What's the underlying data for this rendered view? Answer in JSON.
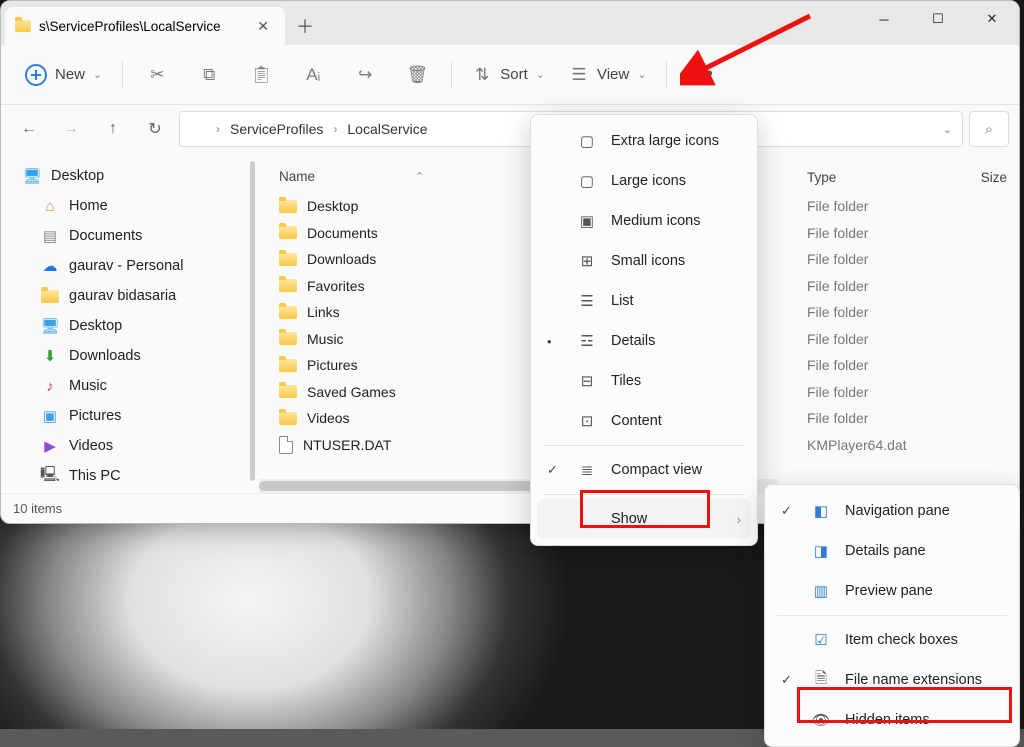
{
  "tab": {
    "title": "s\\ServiceProfiles\\LocalService"
  },
  "toolbar": {
    "new": "New",
    "sort": "Sort",
    "view": "View"
  },
  "breadcrumb": {
    "seg1": "ServiceProfiles",
    "seg2": "LocalService"
  },
  "sidebar": {
    "desktop": "Desktop",
    "home": "Home",
    "documents": "Documents",
    "gaurav_personal": "gaurav - Personal",
    "gaurav_b": "gaurav bidasaria",
    "desktop2": "Desktop",
    "downloads": "Downloads",
    "music": "Music",
    "pictures": "Pictures",
    "videos": "Videos",
    "thispc": "This PC"
  },
  "columns": {
    "name": "Name",
    "type": "Type",
    "size": "Size"
  },
  "files": {
    "f0": "Desktop",
    "f1": "Documents",
    "f2": "Downloads",
    "f3": "Favorites",
    "f4": "Links",
    "f5": "Music",
    "f6": "Pictures",
    "f7": "Saved Games",
    "f8": "Videos",
    "f9": "NTUSER.DAT"
  },
  "types": {
    "folder": "File folder",
    "kmp": "KMPlayer64.dat"
  },
  "status": {
    "count": "10 items"
  },
  "viewMenu": {
    "xl": "Extra large icons",
    "l": "Large icons",
    "m": "Medium icons",
    "s": "Small icons",
    "list": "List",
    "details": "Details",
    "tiles": "Tiles",
    "content": "Content",
    "compact": "Compact view",
    "show": "Show"
  },
  "showMenu": {
    "nav": "Navigation pane",
    "det": "Details pane",
    "prev": "Preview pane",
    "chk": "Item check boxes",
    "ext": "File name extensions",
    "hid": "Hidden items"
  }
}
